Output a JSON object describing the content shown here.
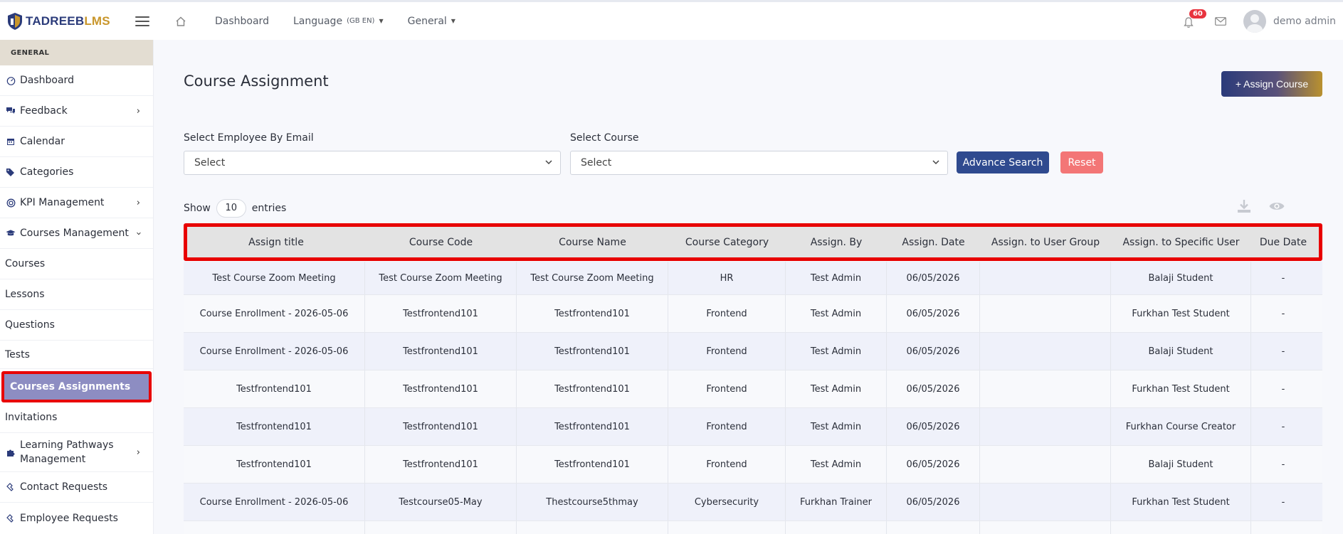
{
  "header": {
    "logo_main": "TADREEB",
    "logo_accent": "LMS",
    "nav": {
      "dashboard": "Dashboard",
      "language": "Language",
      "language_code": "(GB EN)",
      "general": "General"
    },
    "notification_count": "60",
    "user_name": "demo admin"
  },
  "sidebar": {
    "section": "GENERAL",
    "items": [
      {
        "label": "Dashboard",
        "icon": "dashboard-icon"
      },
      {
        "label": "Feedback",
        "icon": "comments-icon"
      },
      {
        "label": "Calendar",
        "icon": "calendar-icon"
      },
      {
        "label": "Categories",
        "icon": "tags-icon"
      },
      {
        "label": "KPI Management",
        "icon": "target-icon"
      },
      {
        "label": "Courses Management",
        "icon": "graduation-cap-icon"
      },
      {
        "label": "Courses"
      },
      {
        "label": "Lessons"
      },
      {
        "label": "Questions"
      },
      {
        "label": "Tests"
      },
      {
        "label": "Courses Assignments"
      },
      {
        "label": "Invitations"
      },
      {
        "label": "Learning Pathways",
        "label2": "Management",
        "icon": "puzzle-icon"
      },
      {
        "label": "Contact Requests",
        "icon": "handshake-icon"
      },
      {
        "label": "Employee Requests",
        "icon": "handshake-icon"
      }
    ]
  },
  "main": {
    "title": "Course Assignment",
    "assign_button": "+ Assign Course",
    "filters": {
      "employee_label": "Select Employee By Email",
      "employee_value": "Select",
      "course_label": "Select Course",
      "course_value": "Select",
      "advance_search": "Advance Search",
      "reset": "Reset"
    },
    "show_label": "Show",
    "entries_value": "10",
    "entries_label": "entries"
  },
  "table": {
    "columns": [
      "Assign title",
      "Course Code",
      "Course Name",
      "Course Category",
      "Assign. By",
      "Assign. Date",
      "Assign. to User Group",
      "Assign. to Specific User",
      "Due Date"
    ],
    "rows": [
      [
        "Test Course Zoom Meeting",
        "Test Course Zoom Meeting",
        "Test Course Zoom Meeting",
        "HR",
        "Test Admin",
        "06/05/2026",
        "",
        "Balaji Student",
        "-"
      ],
      [
        "Course Enrollment - 2026-05-06",
        "Testfrontend101",
        "Testfrontend101",
        "Frontend",
        "Test Admin",
        "06/05/2026",
        "",
        "Furkhan Test Student",
        "-"
      ],
      [
        "Course Enrollment - 2026-05-06",
        "Testfrontend101",
        "Testfrontend101",
        "Frontend",
        "Test Admin",
        "06/05/2026",
        "",
        "Balaji Student",
        "-"
      ],
      [
        "Testfrontend101",
        "Testfrontend101",
        "Testfrontend101",
        "Frontend",
        "Test Admin",
        "06/05/2026",
        "",
        "Furkhan Test Student",
        "-"
      ],
      [
        "Testfrontend101",
        "Testfrontend101",
        "Testfrontend101",
        "Frontend",
        "Test Admin",
        "06/05/2026",
        "",
        "Furkhan Course Creator",
        "-"
      ],
      [
        "Testfrontend101",
        "Testfrontend101",
        "Testfrontend101",
        "Frontend",
        "Test Admin",
        "06/05/2026",
        "",
        "Balaji Student",
        "-"
      ],
      [
        "Course Enrollment - 2026-05-06",
        "Testcourse05-May",
        "Thestcourse5thmay",
        "Cybersecurity",
        "Furkhan Trainer",
        "06/05/2026",
        "",
        "Furkhan Test Student",
        "-"
      ],
      [
        "",
        "",
        "",
        "",
        "",
        "",
        "",
        "",
        ""
      ]
    ]
  }
}
